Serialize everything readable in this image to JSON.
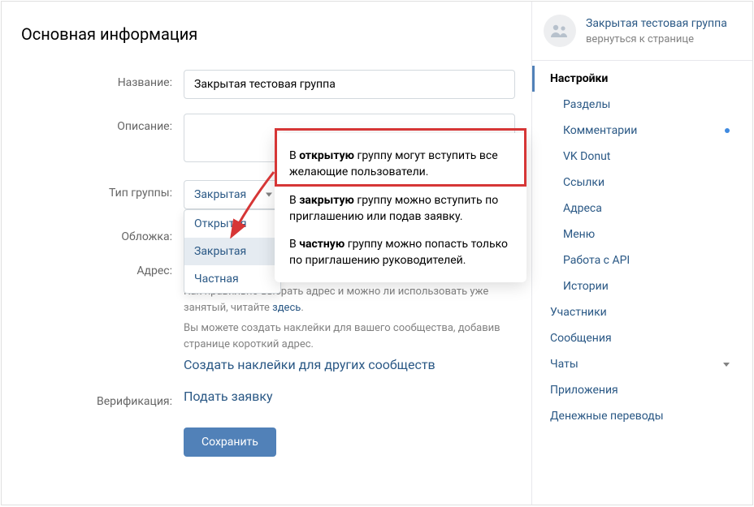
{
  "page_title": "Основная информация",
  "form": {
    "name_label": "Название:",
    "name_value": "Закрытая тестовая группа",
    "desc_label": "Описание:",
    "desc_value": "",
    "type_label": "Тип группы:",
    "type_selected": "Закрытая",
    "type_options": [
      "Открытая",
      "Закрытая",
      "Частная"
    ],
    "cover_label": "Обложка:",
    "address_label": "Адрес:",
    "address_help1_pre": "Как правильно выбрать адрес и можно ли использовать уже занятый, читайте ",
    "address_help1_link": "здесь",
    "address_help1_post": ".",
    "address_help2": "Вы можете создать наклейки для вашего сообщества, добавив странице короткий адрес.",
    "address_help3_link": "Создать наклейки для других сообществ",
    "verif_label": "Верификация:",
    "verif_link": "Подать заявку",
    "save_label": "Сохранить"
  },
  "tooltip": {
    "p1_pre": "В ",
    "p1_bold": "открытую",
    "p1_post": " группу могут вступить все желающие пользователи.",
    "p2_pre": "В ",
    "p2_bold": "закрытую",
    "p2_post": " группу можно вступить по приглашению или подав заявку.",
    "p3_pre": "В ",
    "p3_bold": "частную",
    "p3_post": " группу можно попасть только по приглашению руководителей."
  },
  "sidebar": {
    "group_name": "Закрытая тестовая группа",
    "back_text": "вернуться к странице",
    "items": [
      {
        "label": "Настройки",
        "active": true,
        "sub": false
      },
      {
        "label": "Разделы",
        "sub": true
      },
      {
        "label": "Комментарии",
        "sub": true,
        "dot": true
      },
      {
        "label": "VK Donut",
        "sub": true
      },
      {
        "label": "Ссылки",
        "sub": true
      },
      {
        "label": "Адреса",
        "sub": true
      },
      {
        "label": "Меню",
        "sub": true
      },
      {
        "label": "Работа с API",
        "sub": true
      },
      {
        "label": "Истории",
        "sub": true
      },
      {
        "label": "Участники",
        "sub": false
      },
      {
        "label": "Сообщения",
        "sub": false
      },
      {
        "label": "Чаты",
        "sub": false,
        "chev": true
      },
      {
        "label": "Приложения",
        "sub": false
      },
      {
        "label": "Денежные переводы",
        "sub": false
      }
    ]
  },
  "colors": {
    "accent": "#5181b8",
    "link": "#2a5885",
    "muted": "#828282",
    "highlight": "#d63636"
  }
}
